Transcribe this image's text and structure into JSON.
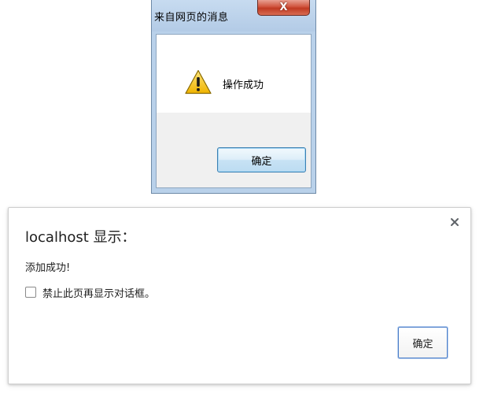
{
  "windows_dialog": {
    "title": "来自网页的消息",
    "close_glyph": "X",
    "icon": "warning-icon",
    "message": "操作成功",
    "ok_label": "确定",
    "colors": {
      "frame": "#b9d1ea",
      "close_button": "#c9462f",
      "warning_yellow": "#f5c518"
    }
  },
  "chrome_dialog": {
    "title": "localhost 显示：",
    "close_glyph": "×",
    "message": "添加成功!",
    "suppress_label": "禁止此页再显示对话框。",
    "suppress_checked": false,
    "ok_label": "确定",
    "colors": {
      "button_border": "#4d7fc9"
    }
  }
}
